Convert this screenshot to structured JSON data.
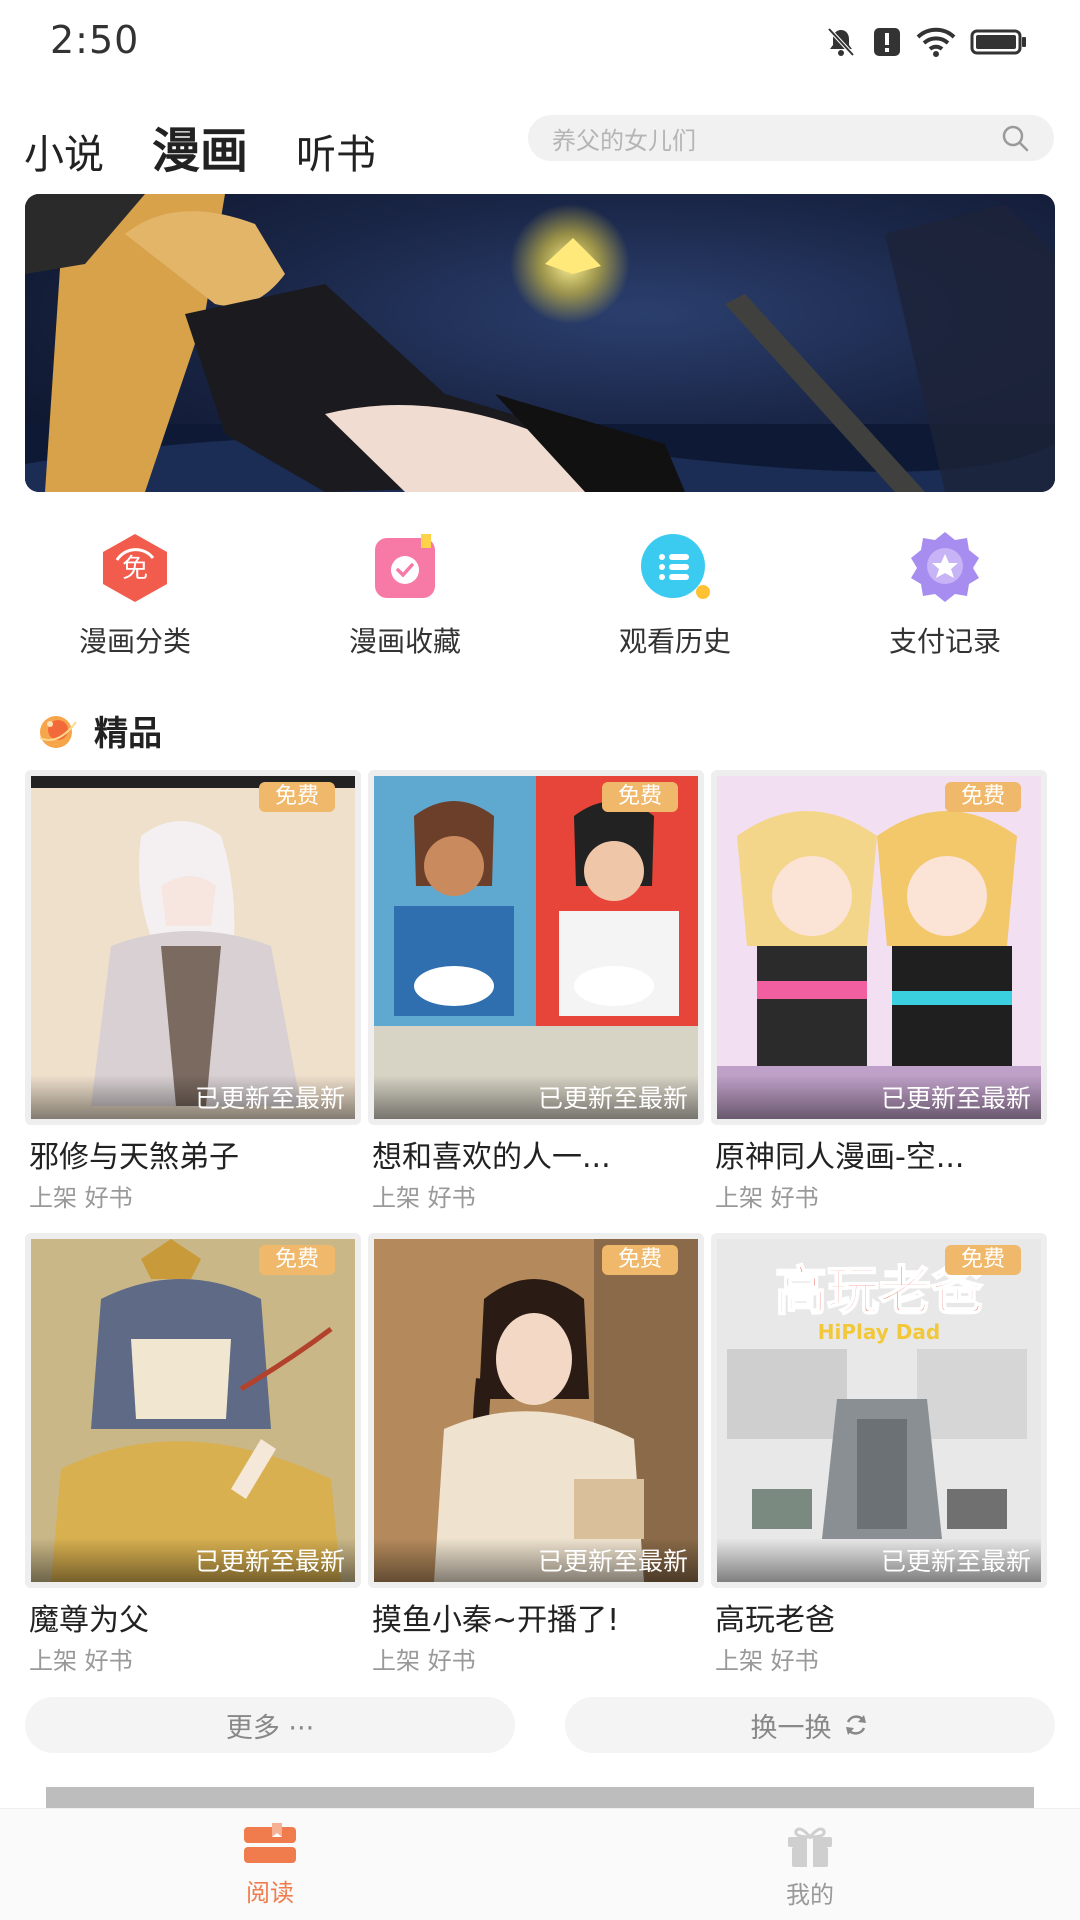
{
  "status_bar": {
    "time": "2:50",
    "icons": [
      "bell-off-icon",
      "alert-icon",
      "wifi-icon",
      "battery-icon"
    ]
  },
  "header": {
    "tabs": [
      {
        "label": "小说",
        "active": false
      },
      {
        "label": "漫画",
        "active": true
      },
      {
        "label": "听书",
        "active": false
      }
    ],
    "search": {
      "placeholder": "养父的女儿们"
    }
  },
  "banner": {
    "icon": "banner-image"
  },
  "quick_menu": [
    {
      "label": "漫画分类",
      "icon": "category-icon",
      "color": "#f25c4c"
    },
    {
      "label": "漫画收藏",
      "icon": "favorite-icon",
      "color": "#f779a6"
    },
    {
      "label": "观看历史",
      "icon": "history-icon",
      "color": "#3ccbf0"
    },
    {
      "label": "支付记录",
      "icon": "payment-record-icon",
      "color": "#a88df0"
    }
  ],
  "section": {
    "title": "精品",
    "icon": "premium-icon"
  },
  "books": [
    {
      "title": "邪修与天煞弟子",
      "subtitle": "上架 好书",
      "badge": "免费",
      "update": "已更新至最新"
    },
    {
      "title": "想和喜欢的人一...",
      "subtitle": "上架 好书",
      "badge": "免费",
      "update": "已更新至最新"
    },
    {
      "title": "原神同人漫画-空...",
      "subtitle": "上架 好书",
      "badge": "免费",
      "update": "已更新至最新"
    },
    {
      "title": "魔尊为父",
      "subtitle": "上架 好书",
      "badge": "免费",
      "update": "已更新至最新"
    },
    {
      "title": "摸鱼小秦~开播了!",
      "subtitle": "上架 好书",
      "badge": "免费",
      "update": "已更新至最新"
    },
    {
      "title": "高玩老爸",
      "subtitle": "上架 好书",
      "badge": "免费",
      "update": "已更新至最新"
    }
  ],
  "actions": {
    "more_label": "更多 ···",
    "refresh_label": "换一换"
  },
  "bottom_nav": [
    {
      "label": "阅读",
      "icon": "book-icon",
      "active": true
    },
    {
      "label": "我的",
      "icon": "gift-icon",
      "active": false
    }
  ],
  "colors": {
    "accent": "#f07b4c",
    "badge": "#f0b86b"
  }
}
